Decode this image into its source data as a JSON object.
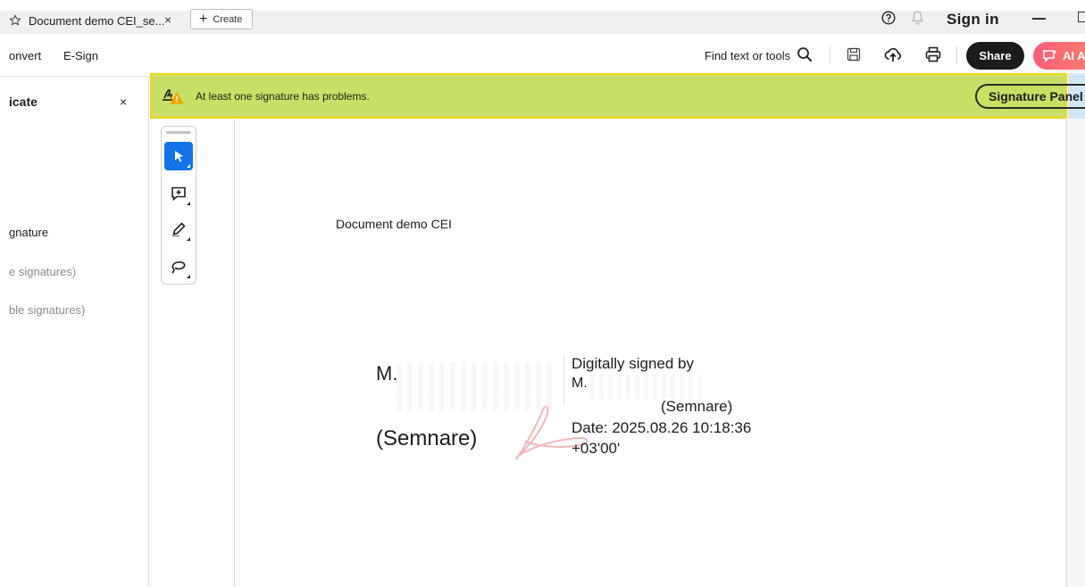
{
  "tabbar": {
    "tab_title": "Document demo CEI_se...",
    "close_glyph": "×",
    "create_label": "Create",
    "create_glyph": "+",
    "sign_in": "Sign in",
    "icons": [
      "star-icon",
      "help-icon",
      "bell-icon",
      "minimize-icon",
      "maximize-icon"
    ]
  },
  "toolbar": {
    "menu": [
      "onvert",
      "E-Sign"
    ],
    "find_placeholder": "Find text or tools",
    "share_label": "Share",
    "ai_label": "AI A",
    "icons": [
      "search-icon",
      "save-icon",
      "upload-icon",
      "print-icon",
      "ai-assistant-icon"
    ]
  },
  "left_panel": {
    "title": "icate",
    "close_glyph": "×",
    "items": [
      {
        "label": "gnature",
        "color": "#1d1d1d"
      },
      {
        "label": "e signatures)",
        "color": "#8a8a8a"
      },
      {
        "label": "ble signatures)",
        "color": "#8a8a8a"
      }
    ]
  },
  "banner": {
    "message": "At least one signature has problems.",
    "button_label": "Signature Panel",
    "background": "#c8e066",
    "border": "#f2d61a",
    "icon": "signature-warning-icon"
  },
  "tools": [
    "select-tool-icon",
    "add-comment-icon",
    "highlight-pen-icon",
    "lasso-draw-icon"
  ],
  "document": {
    "title": "Document demo CEI",
    "signature": {
      "name_initial": "M.",
      "role": "(Semnare)",
      "details": {
        "line1": "Digitally signed by",
        "line2": "M.",
        "line3": "(Semnare)",
        "line4": "Date: 2025.08.26 10:18:36",
        "line5": "+03'00'"
      }
    }
  },
  "colors": {
    "accent_blue": "#1473e6",
    "share_bg": "#1b1b1b",
    "ai_gradient_start": "#ff5d7a",
    "ai_gradient_end": "#f7836e"
  }
}
